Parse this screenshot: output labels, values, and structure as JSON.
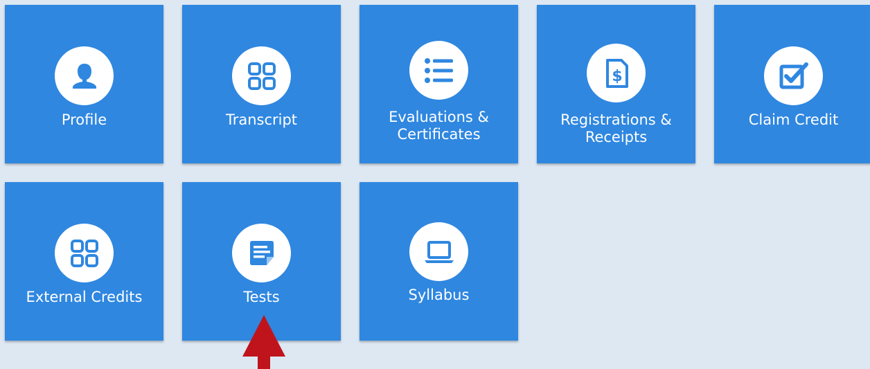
{
  "tiles": [
    {
      "label": "Profile",
      "icon": "user-icon"
    },
    {
      "label": "Transcript",
      "icon": "grid-icon"
    },
    {
      "label": "Evaluations &\nCertificates",
      "icon": "list-icon"
    },
    {
      "label": "Registrations &\nReceipts",
      "icon": "receipt-icon"
    },
    {
      "label": "Claim Credit",
      "icon": "checkbox-icon"
    },
    {
      "label": "External Credits",
      "icon": "grid-icon"
    },
    {
      "label": "Tests",
      "icon": "document-icon"
    },
    {
      "label": "Syllabus",
      "icon": "laptop-icon"
    }
  ],
  "annotation": {
    "icon": "up-arrow-indicator"
  },
  "colors": {
    "background": "#dde8f3",
    "tile": "#2f87e0",
    "icon_fill": "#2f87e0",
    "arrow": "#c0141c"
  }
}
